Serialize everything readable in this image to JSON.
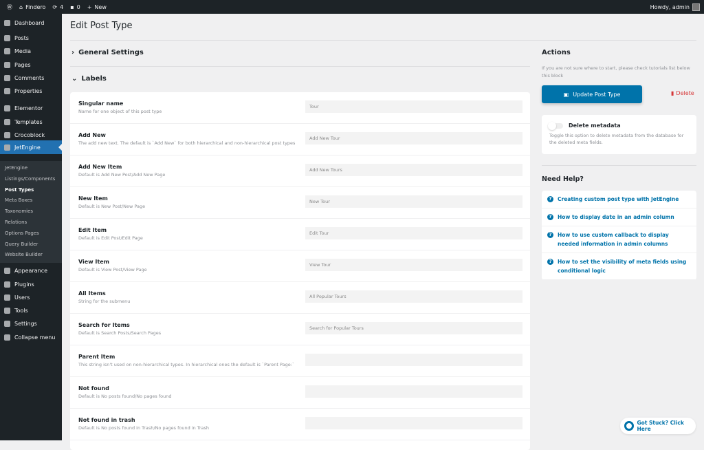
{
  "admin_bar": {
    "site": "Findero",
    "updates": "4",
    "comments": "0",
    "new": "New",
    "howdy": "Howdy, admin"
  },
  "sidebar": {
    "items": [
      "Dashboard",
      "Posts",
      "Media",
      "Pages",
      "Comments",
      "Properties",
      "Elementor",
      "Templates",
      "Crocoblock",
      "JetEngine",
      "Appearance",
      "Plugins",
      "Users",
      "Tools",
      "Settings",
      "Collapse menu"
    ],
    "submenu": [
      "JetEngine",
      "Listings/Components",
      "Post Types",
      "Meta Boxes",
      "Taxonomies",
      "Relations",
      "Options Pages",
      "Query Builder",
      "Website Builder"
    ],
    "current_sub": "Post Types"
  },
  "page": {
    "title": "Edit Post Type",
    "general": "General Settings",
    "labels": "Labels"
  },
  "fields": [
    {
      "label": "Singular name",
      "desc": "Name for one object of this post type",
      "value": "Tour"
    },
    {
      "label": "Add New",
      "desc": "The add new text. The default is `Add New` for both hierarchical and non-hierarchical post types",
      "value": "Add New Tour"
    },
    {
      "label": "Add New Item",
      "desc": "Default is Add New Post/Add New Page",
      "value": "Add New Tours"
    },
    {
      "label": "New Item",
      "desc": "Default is New Post/New Page",
      "value": "New Tour"
    },
    {
      "label": "Edit Item",
      "desc": "Default is Edit Post/Edit Page",
      "value": "Edit Tour"
    },
    {
      "label": "View Item",
      "desc": "Default is View Post/View Page",
      "value": "View Tour"
    },
    {
      "label": "All Items",
      "desc": "String for the submenu",
      "value": "All Popular Tours"
    },
    {
      "label": "Search for Items",
      "desc": "Default is Search Posts/Search Pages",
      "value": "Search for Popular Tours"
    },
    {
      "label": "Parent Item",
      "desc": "This string isn't used on non-hierarchical types. In hierarchical ones the default is `Parent Page:`",
      "value": ""
    },
    {
      "label": "Not found",
      "desc": "Default is No posts found/No pages found",
      "value": ""
    },
    {
      "label": "Not found in trash",
      "desc": "Default is No posts found in Trash/No pages found in Trash",
      "value": ""
    }
  ],
  "actions": {
    "title": "Actions",
    "hint": "If you are not sure where to start, please check tutorials list below this block",
    "update": "Update Post Type",
    "delete": "Delete",
    "meta_title": "Delete metadata",
    "meta_desc": "Toggle this option to delete metadata from the database for the deleted meta fields.",
    "meta_on": false
  },
  "help": {
    "title": "Need Help?",
    "links": [
      "Creating custom post type with JetEngine",
      "How to display date in an admin column",
      "How to use custom callback to display needed information in admin columns",
      "How to set the visibility of meta fields using conditional logic"
    ]
  },
  "stuck": "Got Stuck? Click Here",
  "colors": {
    "accent": "#0073aa",
    "menu_active": "#2271b1",
    "delete": "#d63638"
  }
}
